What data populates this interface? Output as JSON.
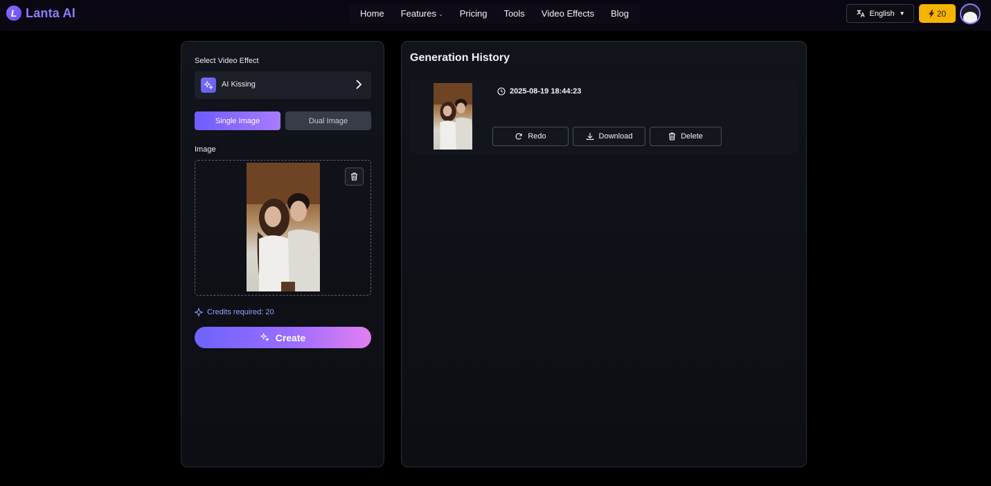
{
  "brand": {
    "name": "Lanta AI",
    "logo_letter": "L"
  },
  "nav": {
    "items": [
      {
        "label": "Home",
        "has_dropdown": false
      },
      {
        "label": "Features",
        "has_dropdown": true
      },
      {
        "label": "Pricing",
        "has_dropdown": false
      },
      {
        "label": "Tools",
        "has_dropdown": false
      },
      {
        "label": "Video Effects",
        "has_dropdown": false
      },
      {
        "label": "Blog",
        "has_dropdown": false
      }
    ],
    "language": "English",
    "credits": "20"
  },
  "left": {
    "select_label": "Select Video Effect",
    "effect_name": "AI Kissing",
    "mode_single": "Single Image",
    "mode_dual": "Dual Image",
    "image_label": "Image",
    "credits_required": "Credits required: 20",
    "create_label": "Create"
  },
  "history": {
    "title": "Generation History",
    "items": [
      {
        "timestamp": "2025-08-19 18:44:23",
        "redo": "Redo",
        "download": "Download",
        "delete": "Delete"
      }
    ]
  },
  "colors": {
    "accent": "#6f5bff",
    "credits": "#f5b400",
    "brand": "#8f7cff"
  }
}
